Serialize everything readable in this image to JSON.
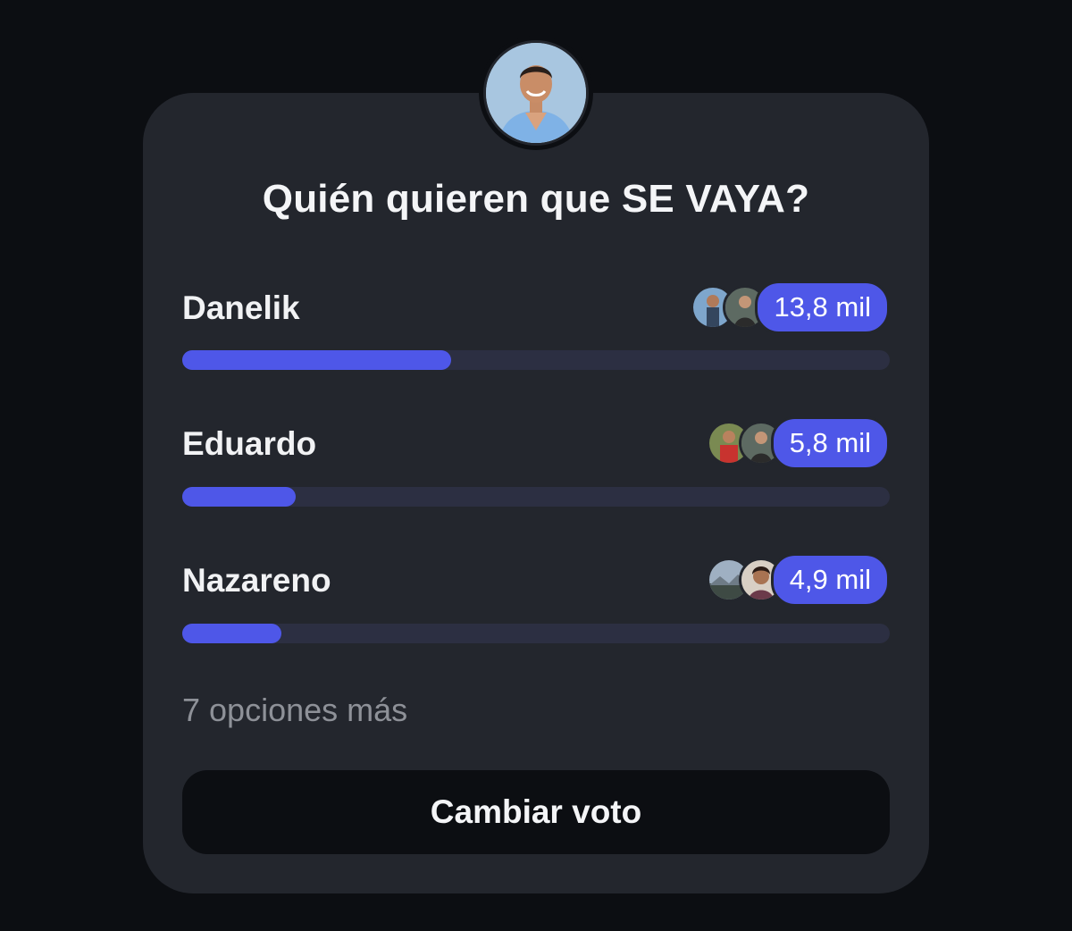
{
  "poll": {
    "question": "Quién quieren que SE VAYA?",
    "creator_avatar": "creator-photo",
    "options": [
      {
        "name": "Danelik",
        "count_label": "13,8 mil",
        "fraction": 0.38,
        "voter_avatars": [
          "voter-photo",
          "voter-photo"
        ]
      },
      {
        "name": "Eduardo",
        "count_label": "5,8 mil",
        "fraction": 0.16,
        "voter_avatars": [
          "voter-photo",
          "voter-photo"
        ]
      },
      {
        "name": "Nazareno",
        "count_label": "4,9 mil",
        "fraction": 0.14,
        "voter_avatars": [
          "voter-photo",
          "voter-photo"
        ]
      }
    ],
    "more_options_label": "7 opciones más",
    "change_vote_label": "Cambiar voto"
  },
  "colors": {
    "background": "#0c0e12",
    "card": "#23262d",
    "accent": "#4e57e8",
    "track": "#2c2f42",
    "muted_text": "#8e9198"
  }
}
